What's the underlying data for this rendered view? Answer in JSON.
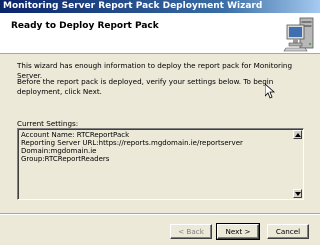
{
  "window": {
    "title": "Monitoring Server Report Pack Deployment Wizard"
  },
  "header": {
    "heading": "Ready to Deploy Report Pack",
    "logo_icon": "server-computer-icon"
  },
  "body": {
    "intro": "This wizard has enough information to deploy the report pack for Monitoring Server.",
    "instructions": "Before the report pack is deployed, verify your settings below. To begin deployment, click Next."
  },
  "settings": {
    "label": "Current Settings:",
    "lines": [
      "Account Name: RTCReportPack",
      "Reporting Server URL:https://reports.mgdomain.ie/reportserver",
      "Domain:mgdomain.ie",
      "Group:RTCReportReaders"
    ]
  },
  "buttons": {
    "back": "< Back",
    "next": "Next >",
    "cancel": "Cancel"
  },
  "colors": {
    "titlebar_start": "#0a246a",
    "titlebar_end": "#a6caf0",
    "dialog_bg": "#ece9d8",
    "header_bg": "#ffffff"
  }
}
